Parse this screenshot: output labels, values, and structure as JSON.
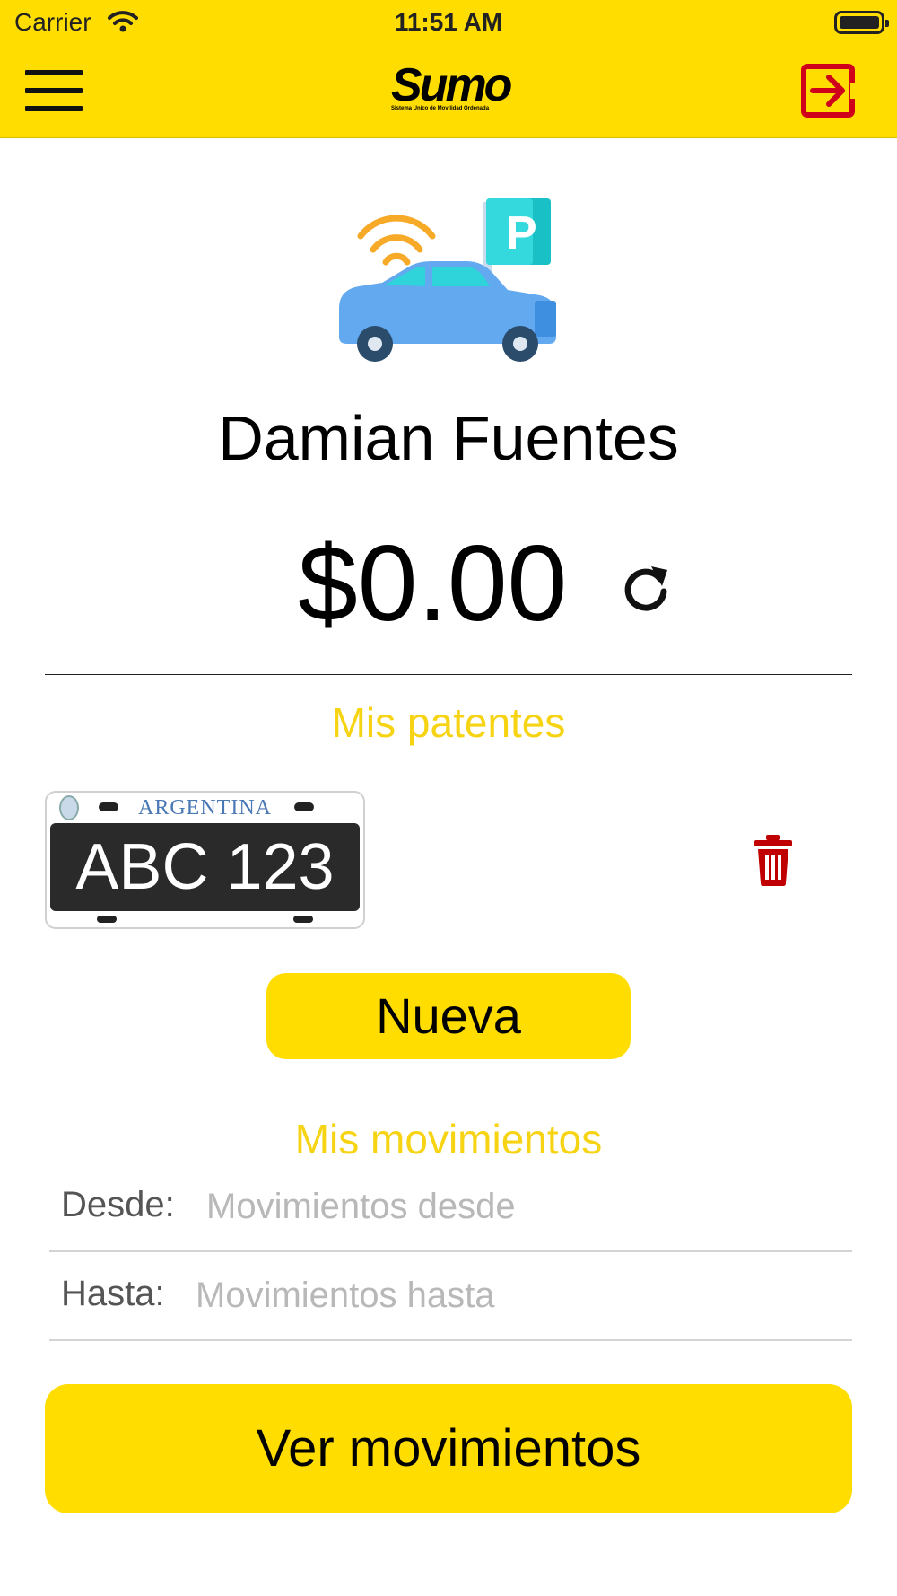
{
  "status_bar": {
    "carrier": "Carrier",
    "time": "11:51 AM"
  },
  "header": {
    "logo_text": "Sumo",
    "logo_subtitle": "Sistema Unico de Movilidad Ordenada",
    "menu_icon": "hamburger-menu-icon",
    "logout_icon": "logout-icon"
  },
  "colors": {
    "brand_yellow": "#FFDD00",
    "section_title": "#F6D414",
    "logout_red": "#D0021B",
    "trash_red": "#C00000"
  },
  "profile": {
    "user_name": "Damian Fuentes",
    "balance": "$0.00",
    "refresh_icon": "refresh-icon"
  },
  "plates_section": {
    "title": "Mis patentes",
    "plates": [
      {
        "country": "ARGENTINA",
        "number": "ABC 123",
        "delete_icon": "trash-icon"
      }
    ],
    "new_button": "Nueva"
  },
  "movements_section": {
    "title": "Mis movimientos",
    "from_label": "Desde:",
    "from_placeholder": "Movimientos desde",
    "from_value": "",
    "to_label": "Hasta:",
    "to_placeholder": "Movimientos hasta",
    "to_value": "",
    "view_button": "Ver movimientos"
  }
}
